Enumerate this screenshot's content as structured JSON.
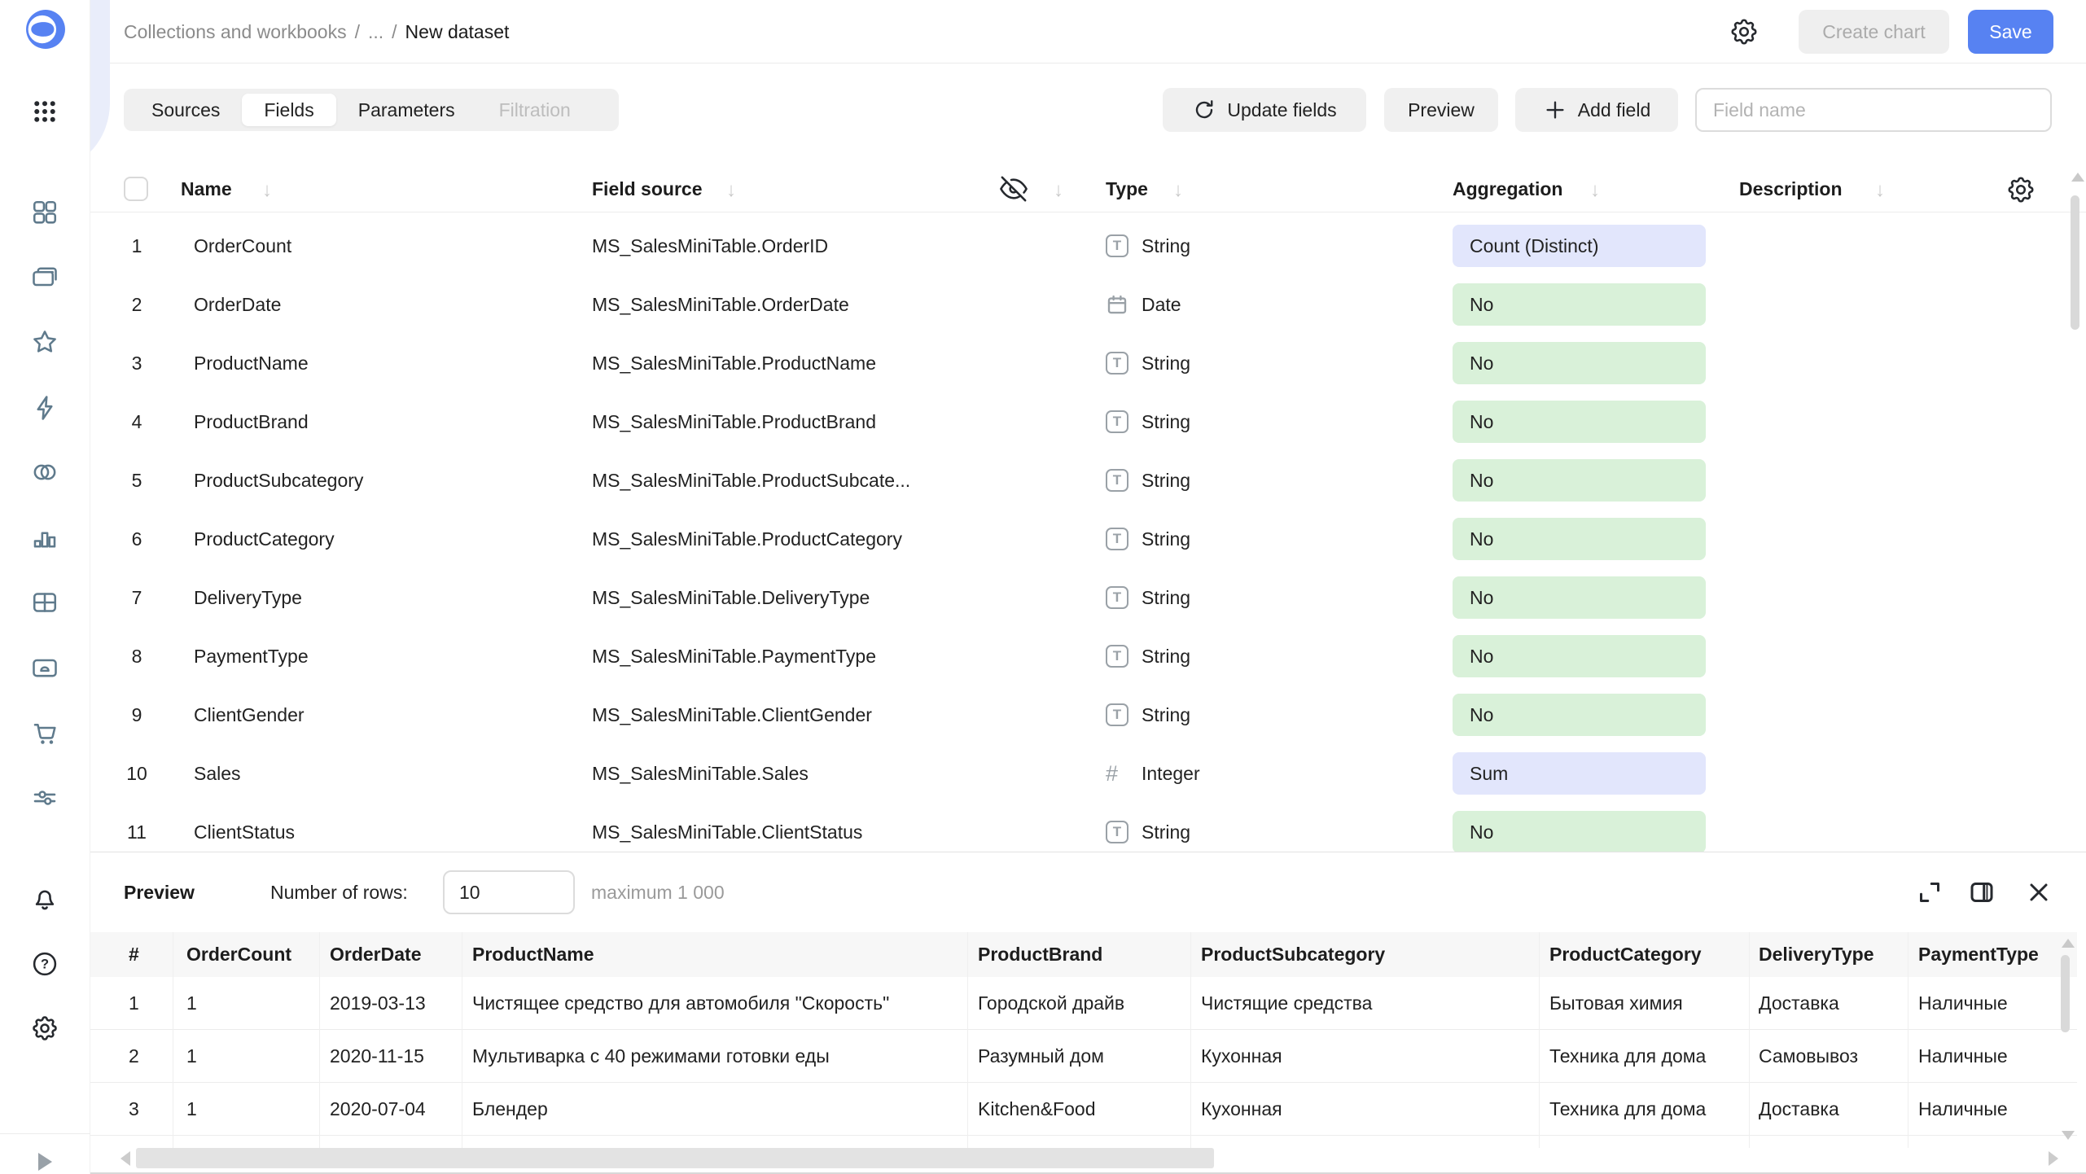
{
  "topbar": {
    "breadcrumb": {
      "root": "Collections and workbooks",
      "sep": "/",
      "ellipsis": "...",
      "current": "New dataset"
    },
    "create_chart": "Create chart",
    "save": "Save"
  },
  "tabs": {
    "items": [
      {
        "label": "Sources"
      },
      {
        "label": "Fields",
        "active": true
      },
      {
        "label": "Parameters"
      },
      {
        "label": "Filtration",
        "disabled": true
      }
    ]
  },
  "toolbar": {
    "update_fields": "Update fields",
    "preview": "Preview",
    "add_field": "Add field",
    "field_name_placeholder": "Field name"
  },
  "fields_table": {
    "headers": {
      "name": "Name",
      "field_source": "Field source",
      "type": "Type",
      "aggregation": "Aggregation",
      "description": "Description"
    },
    "rows": [
      {
        "num": "1",
        "name": "OrderCount",
        "source": "MS_SalesMiniTable.OrderID",
        "type": "String",
        "type_icon": "string",
        "aggregation": "Count (Distinct)",
        "agg_style": "blue"
      },
      {
        "num": "2",
        "name": "OrderDate",
        "source": "MS_SalesMiniTable.OrderDate",
        "type": "Date",
        "type_icon": "date",
        "aggregation": "No",
        "agg_style": "green"
      },
      {
        "num": "3",
        "name": "ProductName",
        "source": "MS_SalesMiniTable.ProductName",
        "type": "String",
        "type_icon": "string",
        "aggregation": "No",
        "agg_style": "green"
      },
      {
        "num": "4",
        "name": "ProductBrand",
        "source": "MS_SalesMiniTable.ProductBrand",
        "type": "String",
        "type_icon": "string",
        "aggregation": "No",
        "agg_style": "green"
      },
      {
        "num": "5",
        "name": "ProductSubcategory",
        "source": "MS_SalesMiniTable.ProductSubcate...",
        "type": "String",
        "type_icon": "string",
        "aggregation": "No",
        "agg_style": "green"
      },
      {
        "num": "6",
        "name": "ProductCategory",
        "source": "MS_SalesMiniTable.ProductCategory",
        "type": "String",
        "type_icon": "string",
        "aggregation": "No",
        "agg_style": "green"
      },
      {
        "num": "7",
        "name": "DeliveryType",
        "source": "MS_SalesMiniTable.DeliveryType",
        "type": "String",
        "type_icon": "string",
        "aggregation": "No",
        "agg_style": "green"
      },
      {
        "num": "8",
        "name": "PaymentType",
        "source": "MS_SalesMiniTable.PaymentType",
        "type": "String",
        "type_icon": "string",
        "aggregation": "No",
        "agg_style": "green"
      },
      {
        "num": "9",
        "name": "ClientGender",
        "source": "MS_SalesMiniTable.ClientGender",
        "type": "String",
        "type_icon": "string",
        "aggregation": "No",
        "agg_style": "green"
      },
      {
        "num": "10",
        "name": "Sales",
        "source": "MS_SalesMiniTable.Sales",
        "type": "Integer",
        "type_icon": "integer",
        "aggregation": "Sum",
        "agg_style": "blue"
      },
      {
        "num": "11",
        "name": "ClientStatus",
        "source": "MS_SalesMiniTable.ClientStatus",
        "type": "String",
        "type_icon": "string",
        "aggregation": "No",
        "agg_style": "green"
      }
    ]
  },
  "preview_panel": {
    "title": "Preview",
    "rows_label": "Number of rows:",
    "rows_value": "10",
    "max_hint": "maximum 1 000"
  },
  "preview_table": {
    "headers": [
      "#",
      "OrderCount",
      "OrderDate",
      "ProductName",
      "ProductBrand",
      "ProductSubcategory",
      "ProductCategory",
      "DeliveryType",
      "PaymentType"
    ],
    "rows": [
      [
        "1",
        "1",
        "2019-03-13",
        "Чистящее средство для автомобиля \"Скорость\"",
        "Городской драйв",
        "Чистящие средства",
        "Бытовая химия",
        "Доставка",
        "Наличные"
      ],
      [
        "2",
        "1",
        "2020-11-15",
        "Мультиварка с 40 режимами готовки еды",
        "Разумный дом",
        "Кухонная",
        "Техника для дома",
        "Самовывоз",
        "Наличные"
      ],
      [
        "3",
        "1",
        "2020-07-04",
        "Блендер",
        "Kitchen&Food",
        "Кухонная",
        "Техника для дома",
        "Доставка",
        "Наличные"
      ]
    ]
  },
  "colors": {
    "accent": "#5782f2",
    "badge_blue": "#e2e6fc",
    "badge_green": "#d9f1d9",
    "sidebar_icon": "#5f7a8c",
    "panel_lavender": "#e9edfa"
  }
}
